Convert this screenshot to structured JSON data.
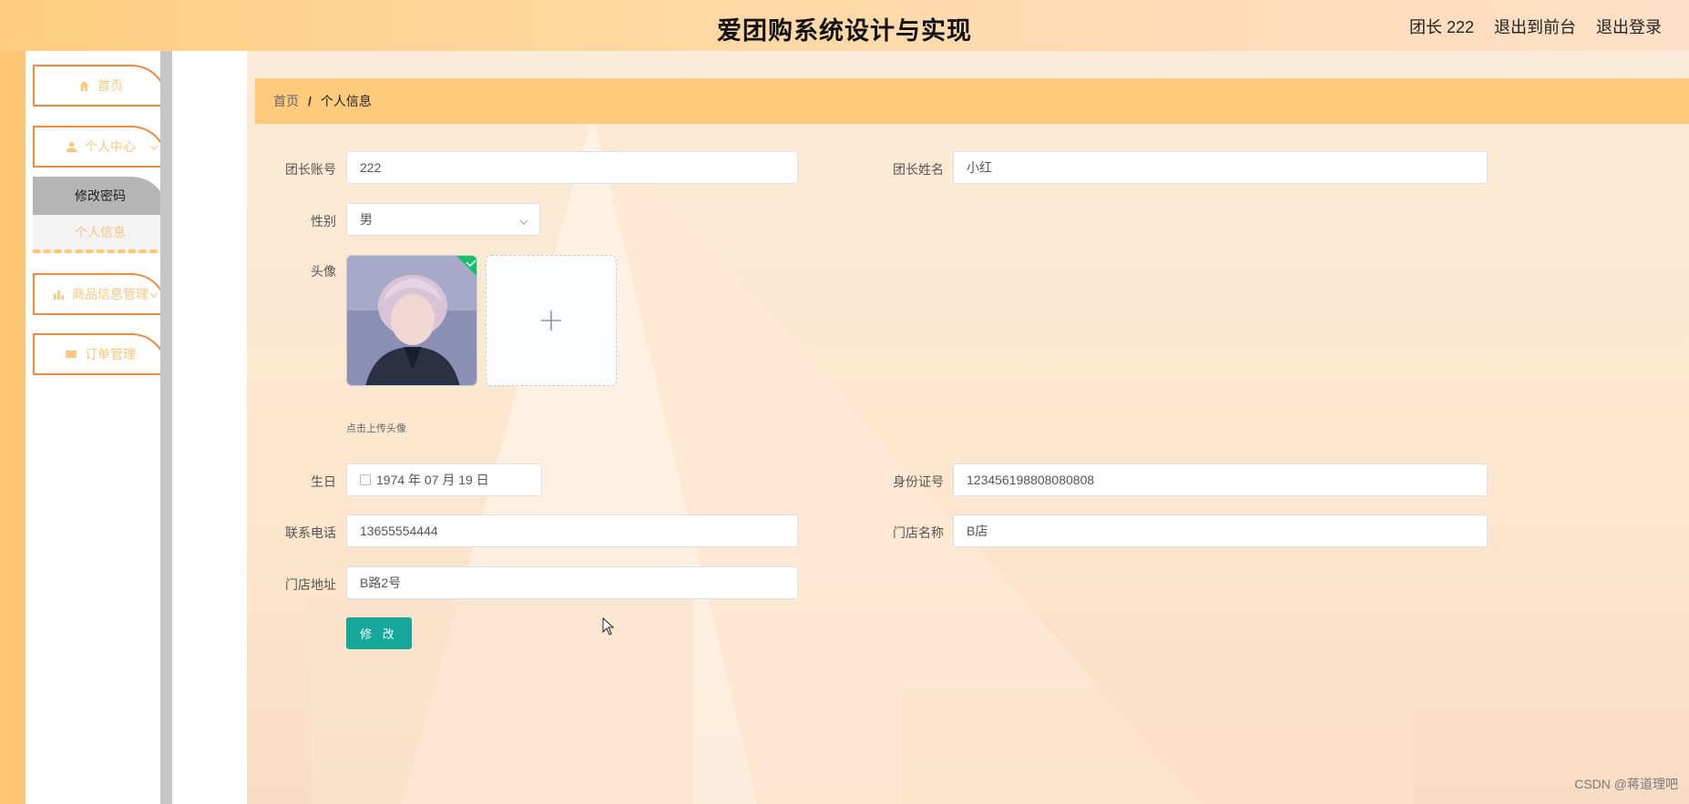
{
  "header": {
    "title": "爱团购系统设计与实现",
    "user_label": "团长 222",
    "front_link": "退出到前台",
    "logout_link": "退出登录"
  },
  "sidebar": {
    "items": [
      {
        "label": "首页",
        "icon": "home-icon"
      },
      {
        "label": "个人中心",
        "icon": "user-icon"
      },
      {
        "label": "商品信息管理",
        "icon": "bar-chart-icon"
      },
      {
        "label": "订单管理",
        "icon": "ticket-icon"
      }
    ],
    "sub_items": [
      {
        "label": "修改密码",
        "active": true
      },
      {
        "label": "个人信息",
        "active": false
      }
    ]
  },
  "breadcrumb": {
    "home": "首页",
    "separator": "/",
    "current": "个人信息"
  },
  "form": {
    "account_label": "团长账号",
    "account_value": "222",
    "name_label": "团长姓名",
    "name_value": "小红",
    "gender_label": "性别",
    "gender_value": "男",
    "avatar_label": "头像",
    "upload_hint": "点击上传头像",
    "birthday_label": "生日",
    "birthday_value": "1974 年 07 月 19 日",
    "idcard_label": "身份证号",
    "idcard_value": "123456198808080808",
    "phone_label": "联系电话",
    "phone_value": "13655554444",
    "store_name_label": "门店名称",
    "store_name_value": "B店",
    "store_addr_label": "门店地址",
    "store_addr_value": "B路2号",
    "submit_label": "修 改"
  },
  "watermark": "CSDN @蒋道理吧",
  "colors": {
    "accent": "#ffca7c",
    "menu_border": "#f0893a",
    "button": "#14a79a"
  }
}
